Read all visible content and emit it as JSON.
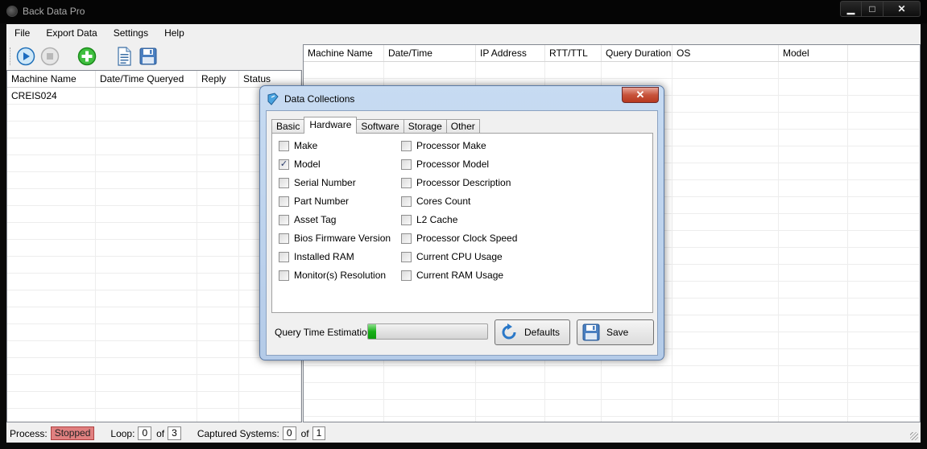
{
  "window": {
    "title": "Back Data Pro"
  },
  "menu": [
    "File",
    "Export Data",
    "Settings",
    "Help"
  ],
  "left_grid": {
    "columns": [
      "Machine Name",
      "Date/Time Queryed",
      "Reply",
      "Status"
    ],
    "rows": [
      [
        "CREIS024",
        "",
        "",
        ""
      ]
    ]
  },
  "right_grid": {
    "columns": [
      "Machine Name",
      "Date/Time",
      "IP Address",
      "RTT/TTL",
      "Query Duration",
      "OS",
      "Model"
    ]
  },
  "status": {
    "process_label": "Process:",
    "process_value": "Stopped",
    "loop_label": "Loop:",
    "loop_current": "0",
    "of1": "of",
    "loop_total": "3",
    "captured_label": "Captured Systems:",
    "captured_current": "0",
    "of2": "of",
    "captured_total": "1",
    "stopped_color": "#e08080"
  },
  "dialog": {
    "title": "Data Collections",
    "tabs": [
      "Basic",
      "Hardware",
      "Software",
      "Storage",
      "Other"
    ],
    "active_tab": "Hardware",
    "left_options": [
      {
        "label": "Make",
        "checked": false
      },
      {
        "label": "Model",
        "checked": true
      },
      {
        "label": "Serial Number",
        "checked": false
      },
      {
        "label": "Part Number",
        "checked": false
      },
      {
        "label": "Asset Tag",
        "checked": false
      },
      {
        "label": "Bios Firmware Version",
        "checked": false
      },
      {
        "label": "Installed RAM",
        "checked": false
      },
      {
        "label": "Monitor(s) Resolution",
        "checked": false
      }
    ],
    "right_options": [
      {
        "label": "Processor Make",
        "checked": false
      },
      {
        "label": "Processor Model",
        "checked": false
      },
      {
        "label": "Processor Description",
        "checked": false
      },
      {
        "label": "Cores Count",
        "checked": false
      },
      {
        "label": "L2 Cache",
        "checked": false
      },
      {
        "label": "Processor Clock Speed",
        "checked": false
      },
      {
        "label": "Current CPU Usage",
        "checked": false
      },
      {
        "label": "Current RAM Usage",
        "checked": false
      }
    ],
    "query_time_label": "Query Time Estimation:",
    "query_time_progress": 0.07,
    "defaults_label": "Defaults",
    "save_label": "Save"
  }
}
